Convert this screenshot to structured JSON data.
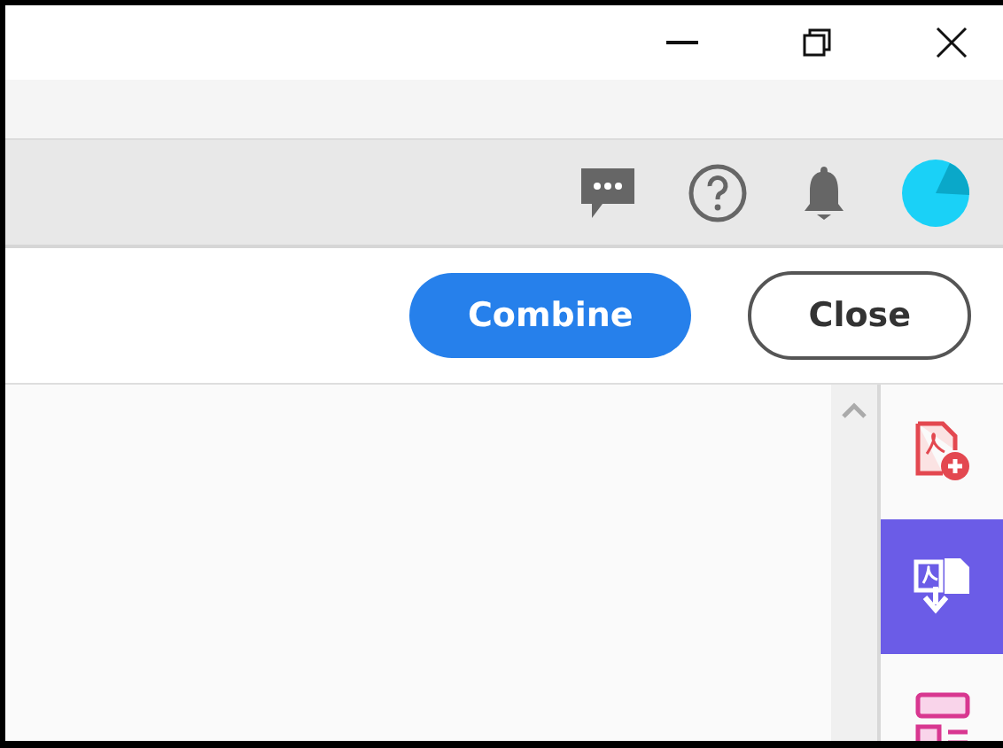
{
  "action_bar": {
    "buttons": [
      {
        "label": "Combine",
        "kind": "primary"
      },
      {
        "label": "Close",
        "kind": "secondary"
      }
    ]
  },
  "tool_rail": [
    {
      "kind": "create",
      "selected": false
    },
    {
      "kind": "export",
      "selected": true
    },
    {
      "kind": "organize",
      "selected": false
    }
  ]
}
